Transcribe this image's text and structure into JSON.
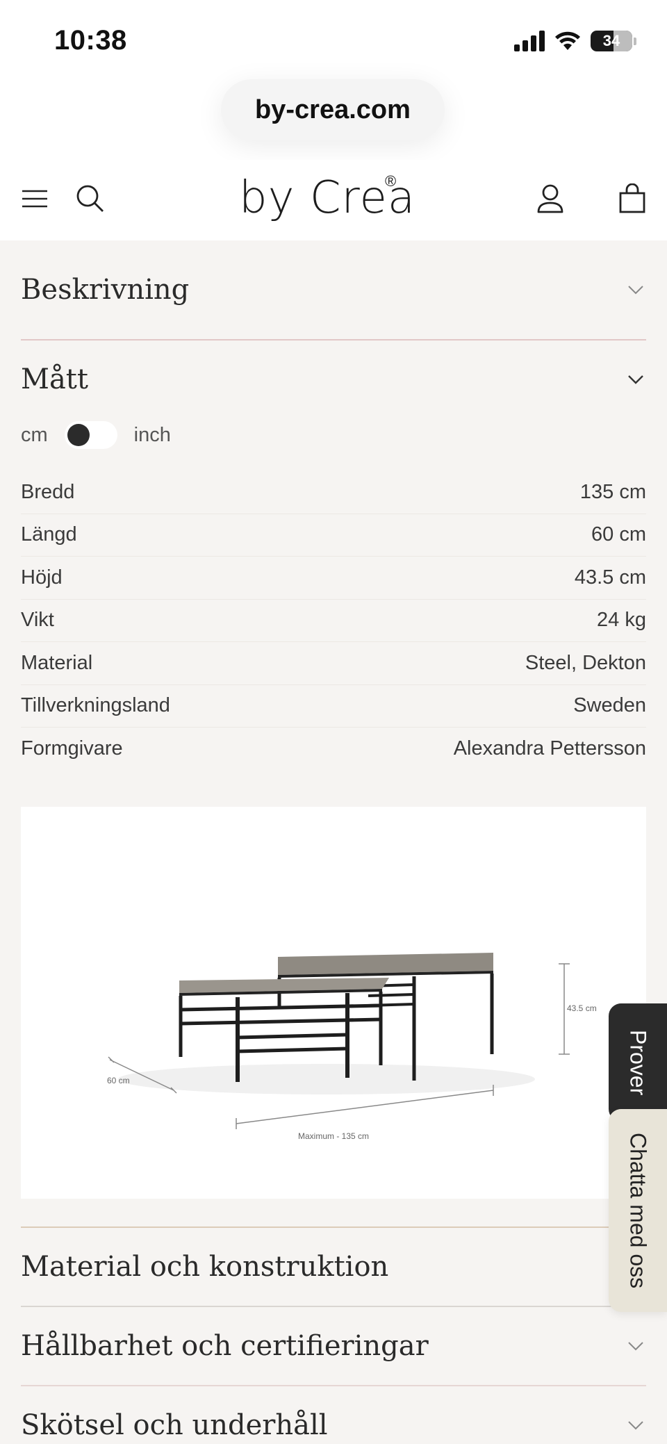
{
  "status_bar": {
    "time": "10:38",
    "battery": "34"
  },
  "browser": {
    "url": "by-crea.com"
  },
  "header": {
    "logo": "by Crea",
    "logo_mark": "®"
  },
  "accordion": {
    "beskrivning": "Beskrivning",
    "matt": "Mått",
    "material": "Material och konstruktion",
    "hallbarhet": "Hållbarhet och certifieringar",
    "skotsel": "Skötsel och underhåll"
  },
  "units": {
    "cm": "cm",
    "inch": "inch",
    "selected": "cm"
  },
  "specs": [
    {
      "label": "Bredd",
      "value": "135 cm"
    },
    {
      "label": "Längd",
      "value": "60 cm"
    },
    {
      "label": "Höjd",
      "value": "43.5 cm"
    },
    {
      "label": "Vikt",
      "value": "24 kg"
    },
    {
      "label": "Material",
      "value": "Steel, Dekton"
    },
    {
      "label": "Tillverkningsland",
      "value": "Sweden"
    },
    {
      "label": "Formgivare",
      "value": "Alexandra Pettersson"
    }
  ],
  "diagram": {
    "depth_label": "60 cm",
    "height_label": "43.5 cm",
    "width_label": "Maximum - 135 cm"
  },
  "side_tabs": {
    "prover": "Prover",
    "chat": "Chatta med oss"
  },
  "colors": {
    "page_bg": "#f6f4f2",
    "tab_dark": "#2b2b2b",
    "tab_light": "#e8e4d8"
  }
}
